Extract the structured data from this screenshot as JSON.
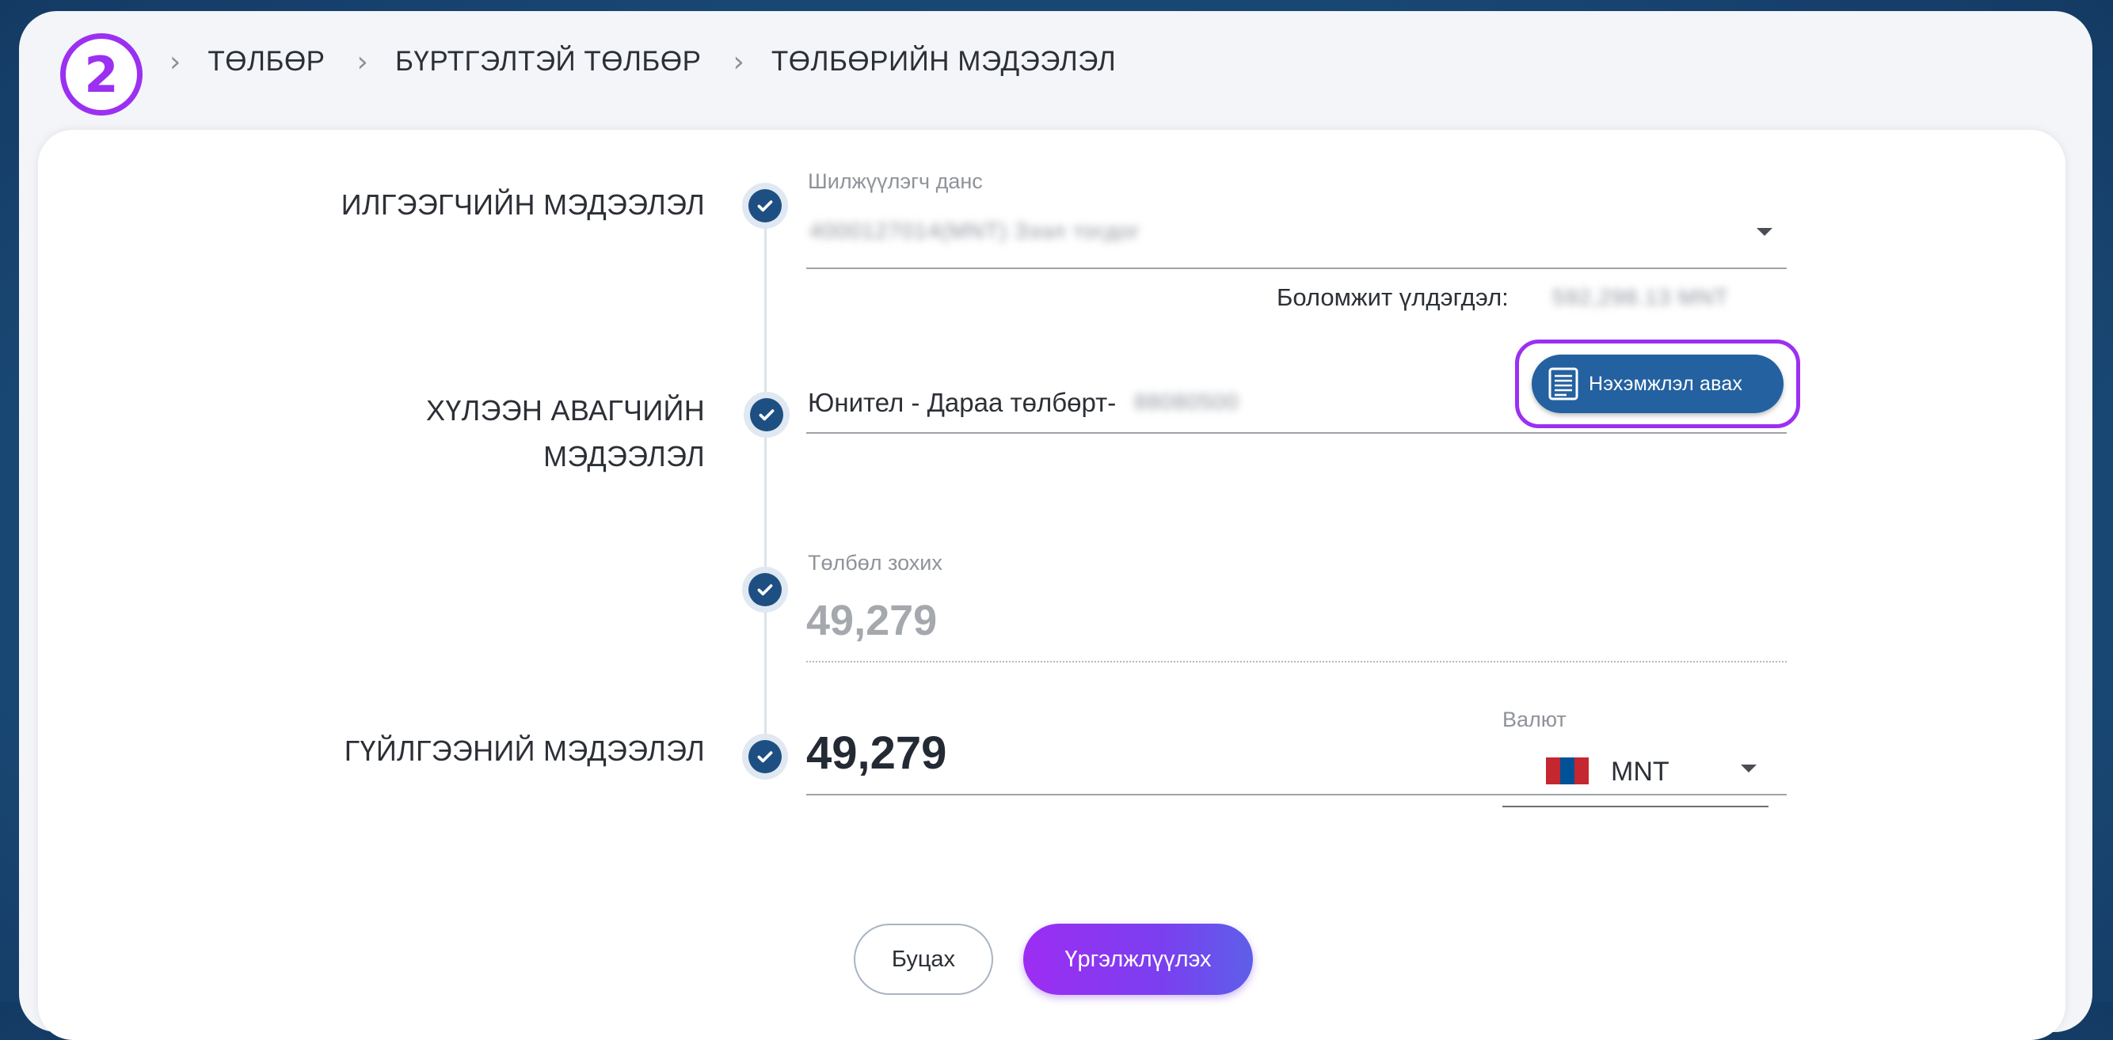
{
  "step": {
    "number": "2"
  },
  "breadcrumb": [
    "ТӨЛБӨР",
    "БҮРТГЭЛТЭЙ ТӨЛБӨР",
    "ТӨЛБӨРИЙН МЭДЭЭЛЭЛ"
  ],
  "sections": {
    "sender": "ИЛГЭЭГЧИЙН МЭДЭЭЛЭЛ",
    "receiver_line1": "ХҮЛЭЭН АВАГЧИЙН",
    "receiver_line2": "МЭДЭЭЛЭЛ",
    "transaction": "ГҮЙЛГЭЭНИЙ МЭДЭЭЛЭЛ"
  },
  "sender": {
    "account_label": "Шилжүүлэгч данс",
    "account_value": "4000127014(MNT) Зээл тогдог",
    "balance_label": "Боломжит үлдэгдэл:",
    "balance_value": "592,298.13 MNT"
  },
  "receiver": {
    "value_prefix": "Юнител - Дараа төлбөрт-",
    "value_blurred": "88080500",
    "invoice_button": "Нэхэмжлэл авах"
  },
  "due": {
    "label": "Төлбөл зохих",
    "amount": "49,279"
  },
  "transaction": {
    "amount": "49,279",
    "currency_label": "Валют",
    "currency_value": "MNT",
    "flag_colors": [
      "#c4272f",
      "#015197",
      "#c4272f"
    ]
  },
  "buttons": {
    "back": "Буцах",
    "continue": "Үргэлжлүүлэх"
  },
  "colors": {
    "accent_purple": "#9b30f2",
    "primary_blue": "#1e4f82"
  }
}
